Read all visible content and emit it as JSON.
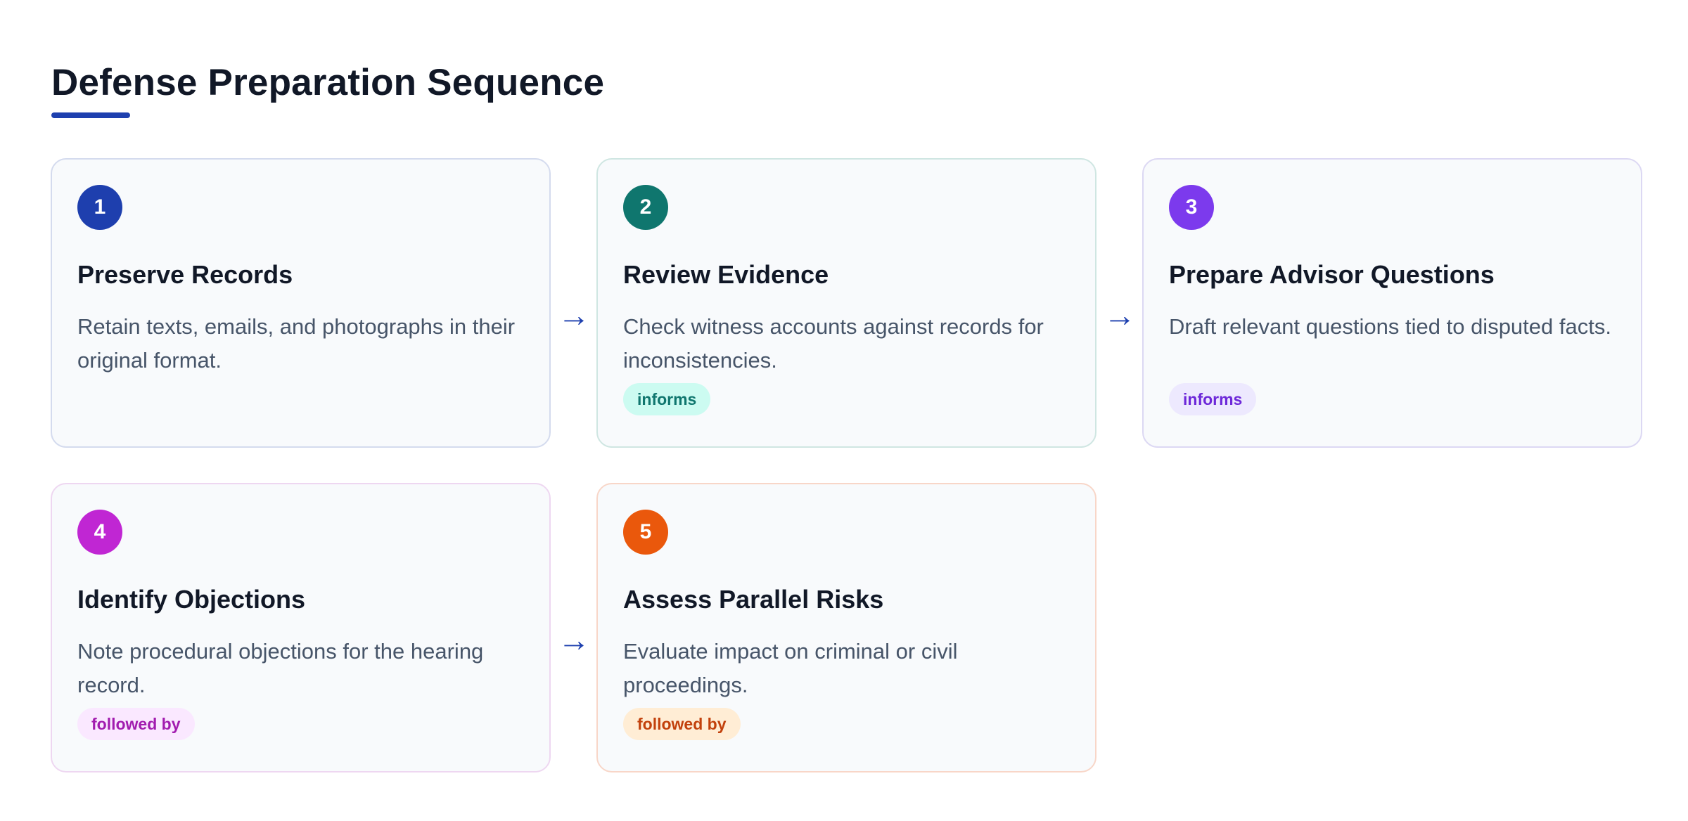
{
  "title": "Defense Preparation Sequence",
  "accent_color": "#1e40af",
  "arrow_symbol": "→",
  "steps": [
    {
      "number": "1",
      "title": "Preserve Records",
      "description": "Retain texts, emails, and photographs in their original format.",
      "tag": "",
      "color": "#1e3fae"
    },
    {
      "number": "2",
      "title": "Review Evidence",
      "description": "Check witness accounts against records for inconsistencies.",
      "tag": "informs",
      "color": "#0f766e",
      "tag_bg": "#ccfbf1",
      "tag_color": "#0f766e"
    },
    {
      "number": "3",
      "title": "Prepare Advisor Questions",
      "description": "Draft relevant questions tied to disputed facts.",
      "tag": "informs",
      "color": "#7c3aed",
      "tag_bg": "#ede9fe",
      "tag_color": "#6d28d9"
    },
    {
      "number": "4",
      "title": "Identify Objections",
      "description": "Note procedural objections for the hearing record.",
      "tag": "followed by",
      "color": "#c026d3",
      "tag_bg": "#fae8ff",
      "tag_color": "#a21caf"
    },
    {
      "number": "5",
      "title": "Assess Parallel Risks",
      "description": "Evaluate impact on criminal or civil proceedings.",
      "tag": "followed by",
      "color": "#ea580c",
      "tag_bg": "#ffedd5",
      "tag_color": "#c2410c"
    }
  ]
}
